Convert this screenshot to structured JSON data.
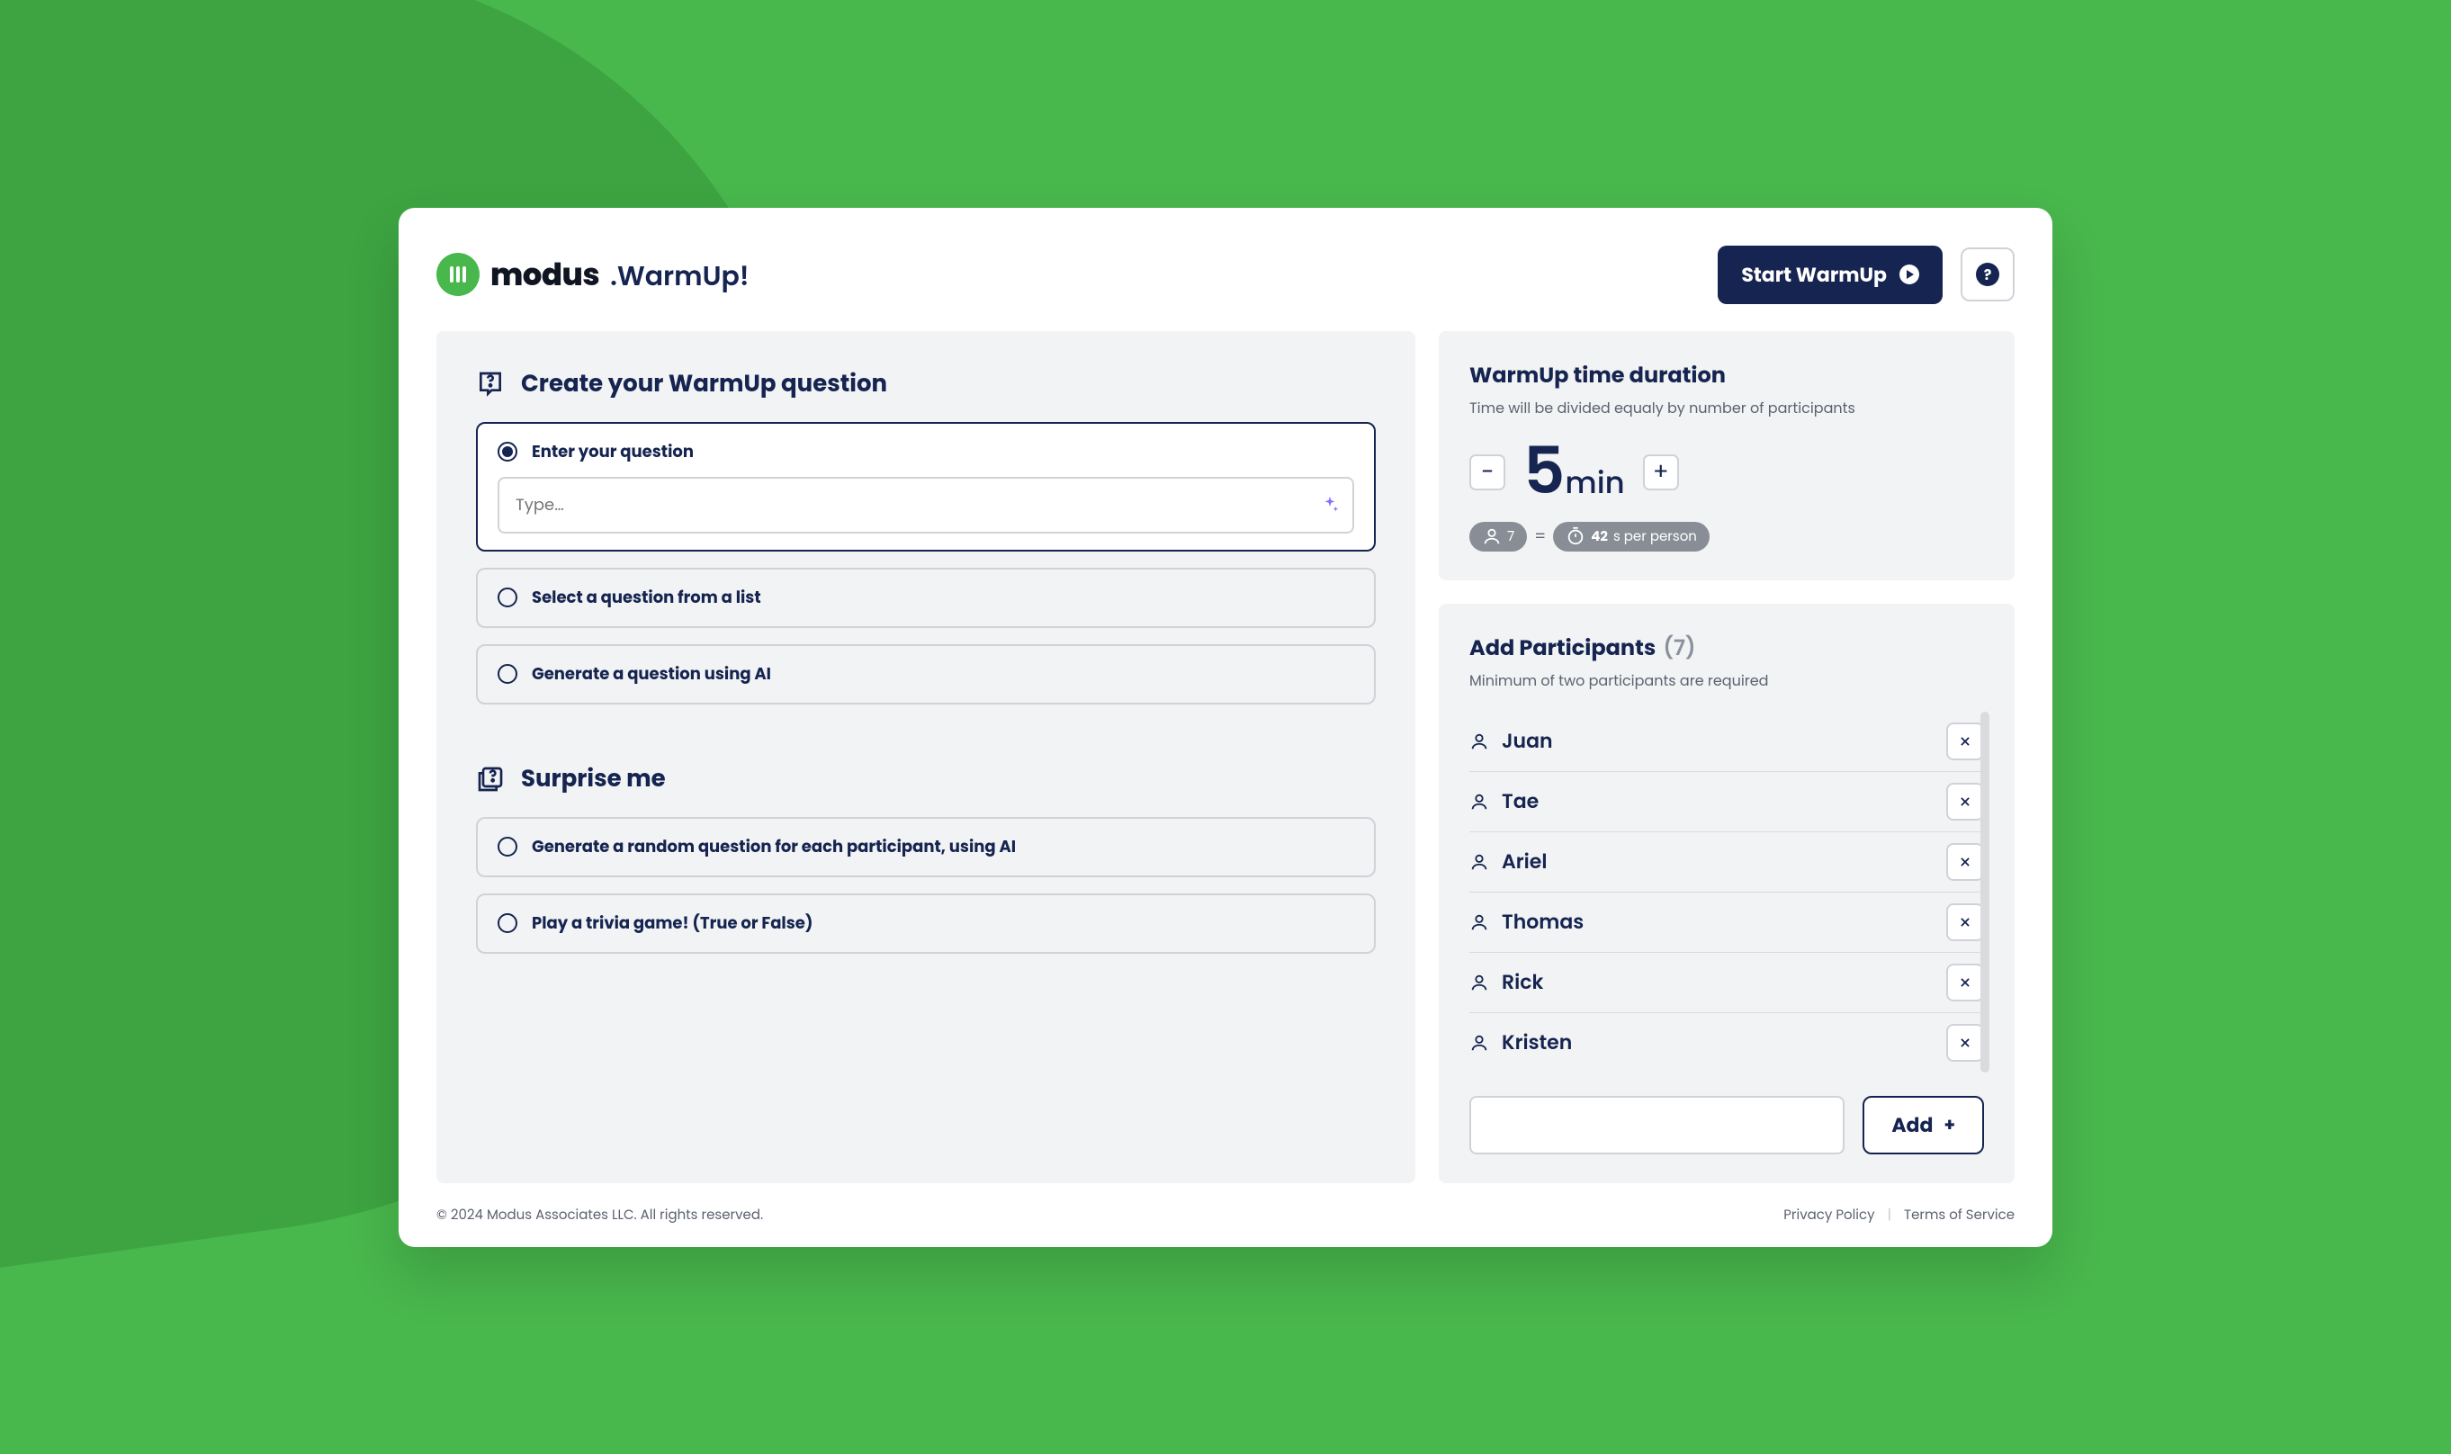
{
  "brand": {
    "name": "modus",
    "product": ".WarmUp!"
  },
  "header": {
    "start_label": "Start WarmUp",
    "help_glyph": "?"
  },
  "create": {
    "title": "Create your WarmUp question",
    "options": {
      "enter": {
        "label": "Enter your question",
        "placeholder": "Type…"
      },
      "select": {
        "label": "Select a question from a list"
      },
      "ai": {
        "label": "Generate a question using AI"
      }
    }
  },
  "surprise": {
    "title": "Surprise me",
    "options": {
      "random_ai": {
        "label": "Generate a random question for each participant, using AI"
      },
      "trivia": {
        "label": "Play a trivia game! (True or False)"
      }
    }
  },
  "duration": {
    "title": "WarmUp time duration",
    "subtitle": "Time will be divided equaly by number of participants",
    "value": "5",
    "unit": "min",
    "minus": "−",
    "plus": "+",
    "people_count": "7",
    "equals": "=",
    "per_person_value": "42",
    "per_person_suffix": "s per person"
  },
  "participants": {
    "title": "Add Participants",
    "count_display": "(7)",
    "subtitle": "Minimum of two participants are required",
    "list": [
      "Juan",
      "Tae",
      "Ariel",
      "Thomas",
      "Rick",
      "Kristen"
    ],
    "add_label": "Add",
    "add_plus": "+"
  },
  "footer": {
    "copyright": "© 2024 Modus Associates LLC. All rights reserved.",
    "privacy": "Privacy Policy",
    "separator": "|",
    "terms": "Terms of Service"
  }
}
